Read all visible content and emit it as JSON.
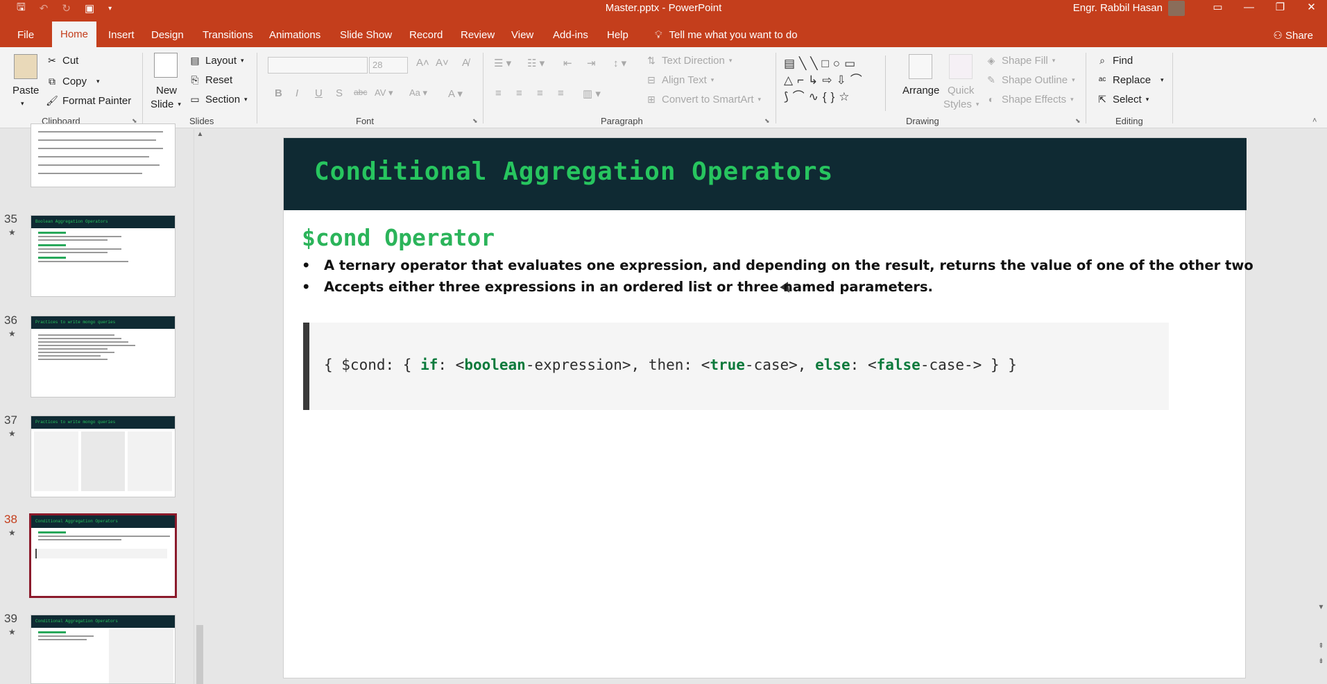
{
  "titlebar": {
    "doc_title": "Master.pptx  -  PowerPoint",
    "user_name": "Engr. Rabbil Hasan"
  },
  "tabs": {
    "file": "File",
    "home": "Home",
    "insert": "Insert",
    "design": "Design",
    "transitions": "Transitions",
    "animations": "Animations",
    "slideshow": "Slide Show",
    "record": "Record",
    "review": "Review",
    "view": "View",
    "addins": "Add-ins",
    "help": "Help",
    "tell_me": "Tell me what you want to do",
    "share": "Share"
  },
  "ribbon": {
    "clipboard": {
      "label": "Clipboard",
      "paste": "Paste",
      "cut": "Cut",
      "copy": "Copy",
      "format_painter": "Format Painter"
    },
    "slides": {
      "label": "Slides",
      "new_slide_line1": "New",
      "new_slide_line2": "Slide",
      "layout": "Layout",
      "reset": "Reset",
      "section": "Section"
    },
    "font": {
      "label": "Font",
      "font_size": "28"
    },
    "paragraph": {
      "label": "Paragraph",
      "text_direction": "Text Direction",
      "align_text": "Align Text",
      "convert_smartart": "Convert to SmartArt"
    },
    "drawing": {
      "label": "Drawing",
      "arrange": "Arrange",
      "quick_styles_line1": "Quick",
      "quick_styles_line2": "Styles",
      "shape_fill": "Shape Fill",
      "shape_outline": "Shape Outline",
      "shape_effects": "Shape Effects"
    },
    "editing": {
      "label": "Editing",
      "find": "Find",
      "replace": "Replace",
      "select": "Select"
    }
  },
  "thumbnails": [
    {
      "num": "35",
      "title": "Boolean Aggregation Operators"
    },
    {
      "num": "36",
      "title": "Practices to write mongo queries"
    },
    {
      "num": "37",
      "title": "Practices to write mongo queries"
    },
    {
      "num": "38",
      "title": "Conditional Aggregation Operators"
    },
    {
      "num": "39",
      "title": "Conditional Aggregation Operators"
    }
  ],
  "slide": {
    "title": "Conditional Aggregation Operators",
    "subtitle": "$cond Operator",
    "bullets": [
      "A ternary operator that evaluates one expression, and depending on the result, returns the value of one of the other two",
      "Accepts either three expressions in an ordered list or three named parameters."
    ],
    "code": {
      "open": "{ $cond: { ",
      "kw_if": "if",
      "part1": ": <",
      "kw_bool": "boolean",
      "part2": "-expression>, then: <",
      "kw_true": "true",
      "part3": "-case>, ",
      "kw_else": "else",
      "part4": ": <",
      "kw_false": "false",
      "part5": "-case-> } }"
    }
  },
  "colors": {
    "accent": "#c43e1c",
    "slide_header_bg": "#0f2a33",
    "slide_title": "#27c55f",
    "selected_thumb_border": "#8b1a2b"
  }
}
